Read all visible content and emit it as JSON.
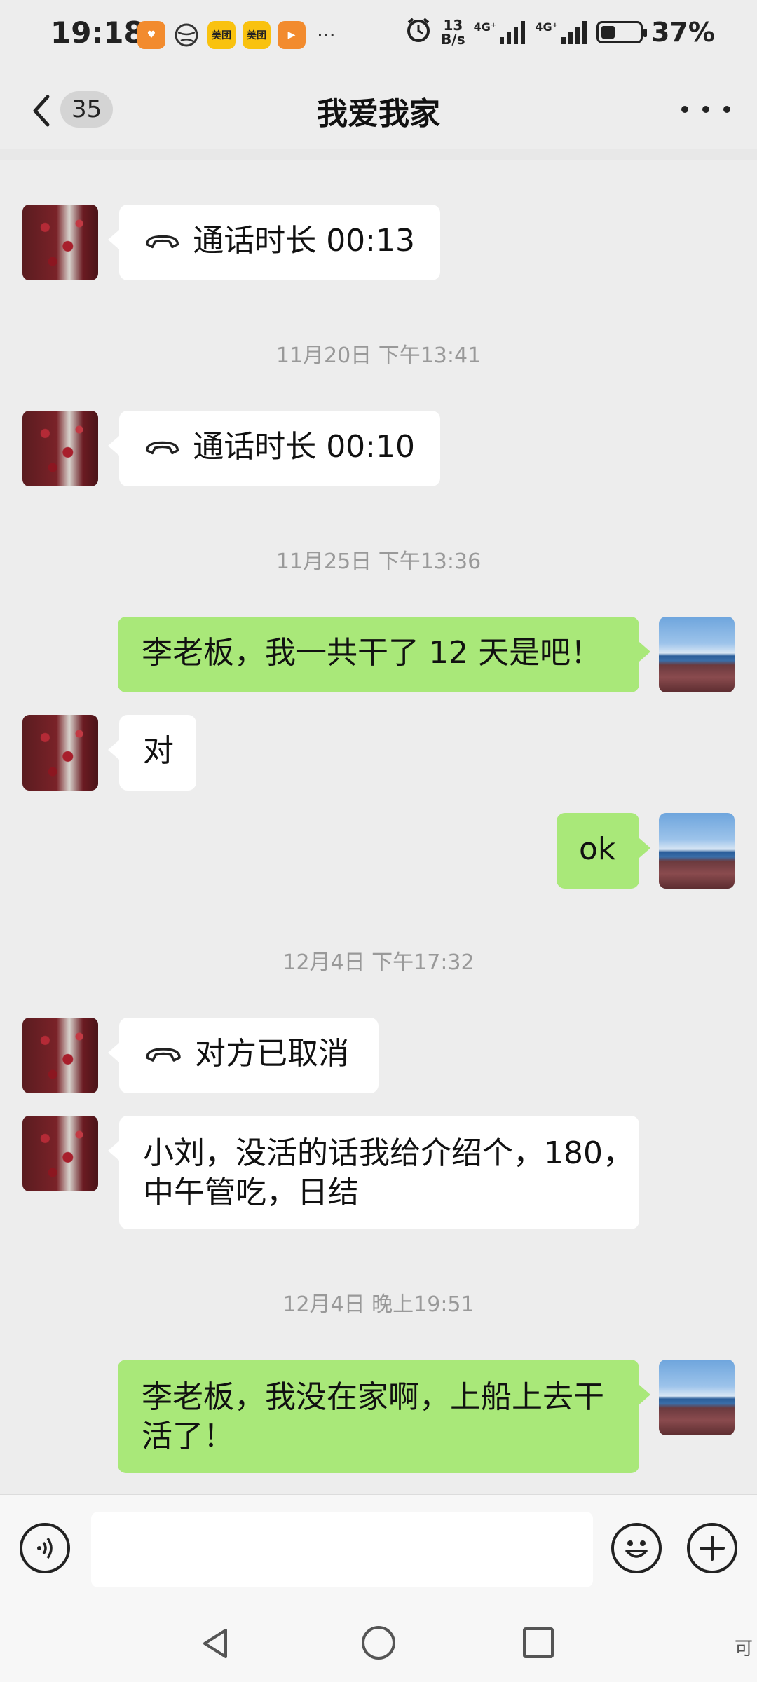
{
  "status_bar": {
    "time": "19:18",
    "app_icons": [
      {
        "name": "heart-app",
        "color": "#f28b2e",
        "label": ""
      },
      {
        "name": "globe",
        "color": "",
        "label": ""
      },
      {
        "name": "meituan-1",
        "color": "#f9c20f",
        "label": "美团"
      },
      {
        "name": "meituan-2",
        "color": "#f9c20f",
        "label": "美团"
      },
      {
        "name": "play-app",
        "color": "#f28b2e",
        "label": ""
      }
    ],
    "more": "···",
    "net_speed_top": "13",
    "net_speed_unit": "B/s",
    "sig1": "4G⁺",
    "sig2": "4G⁺",
    "battery": "37%",
    "battery_level": 0.37
  },
  "header": {
    "back_count": "35",
    "title": "我爱我家"
  },
  "messages": {
    "call1": "通话时长 00:13",
    "ts1": "11月20日 下午13:41",
    "call2": "通话时长 00:10",
    "ts2": "11月25日 下午13:36",
    "r1": "李老板，我一共干了 12 天是吧！",
    "l1": "对",
    "r2": "ok",
    "ts3": "12月4日 下午17:32",
    "call3": "对方已取消",
    "l2_line1": "小刘，没活的话我给介绍个，180，",
    "l2_line2": "中午管吃，日结",
    "ts4": "12月4日 晚上19:51",
    "r3_line1": "李老板，我没在家啊，上船上去干",
    "r3_line2": "活了！"
  },
  "input": {
    "placeholder": ""
  },
  "watermark": "可"
}
